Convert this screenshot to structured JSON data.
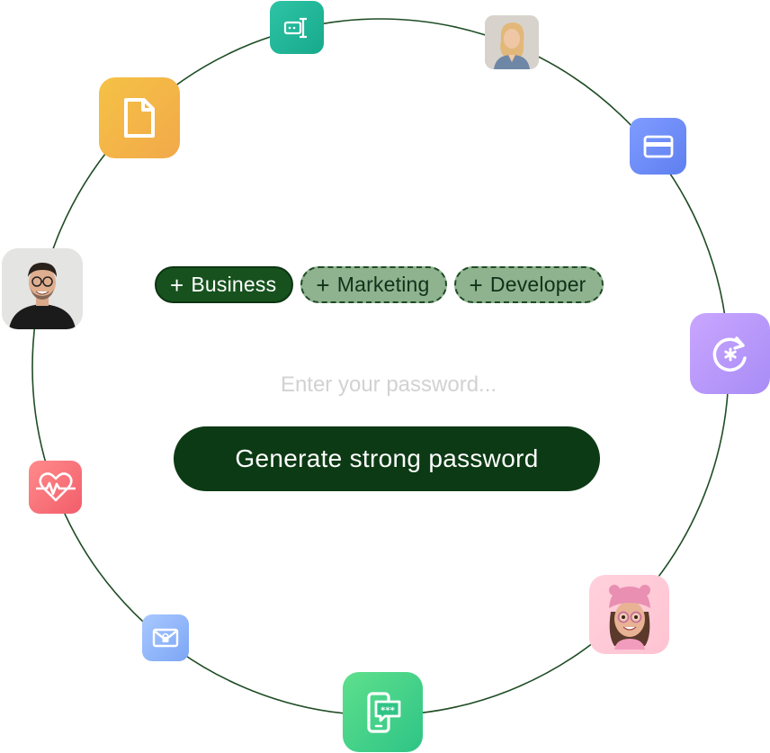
{
  "tags": [
    {
      "label": "Business",
      "active": true
    },
    {
      "label": "Marketing",
      "active": false
    },
    {
      "label": "Developer",
      "active": false
    }
  ],
  "tag_prefix": "+",
  "password_input": {
    "placeholder": "Enter your password...",
    "value": ""
  },
  "generate_button": {
    "label": "Generate strong password"
  },
  "colors": {
    "ring": "#1f4d25",
    "button_bg": "#0c3a14",
    "tag_active_bg": "#17521e",
    "tag_inactive_bg": "#8eb38e"
  },
  "icons": [
    "text-cursor-icon",
    "document-icon",
    "credit-card-icon",
    "reset-password-icon",
    "heart-pulse-icon",
    "email-lock-icon",
    "phone-password-icon"
  ],
  "avatars": [
    "woman-photo-avatar",
    "man-photo-avatar",
    "memoji-avatar"
  ]
}
